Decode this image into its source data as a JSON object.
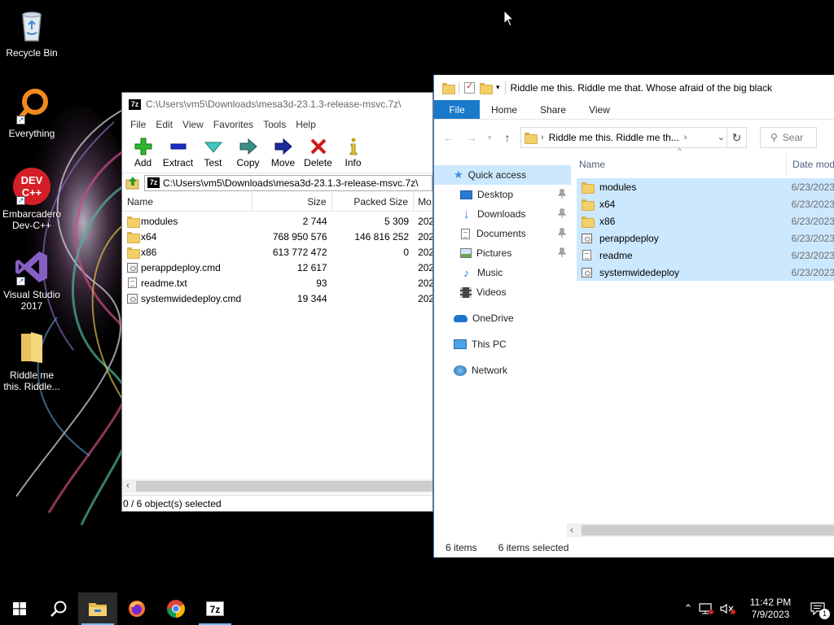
{
  "desktop": {
    "icons": [
      {
        "label": "Recycle Bin"
      },
      {
        "label": "Everything"
      },
      {
        "label": "Embarcadero Dev-C++",
        "badge": "DEV C++"
      },
      {
        "label": "Visual Studio 2017"
      },
      {
        "label": "Riddle me this. Riddle..."
      }
    ]
  },
  "zip": {
    "title": "C:\\Users\\vm5\\Downloads\\mesa3d-23.1.3-release-msvc.7z\\",
    "logo": "7z",
    "menu": [
      "File",
      "Edit",
      "View",
      "Favorites",
      "Tools",
      "Help"
    ],
    "toolbar": [
      "Add",
      "Extract",
      "Test",
      "Copy",
      "Move",
      "Delete",
      "Info"
    ],
    "address": "C:\\Users\\vm5\\Downloads\\mesa3d-23.1.3-release-msvc.7z\\",
    "columns": {
      "name": "Name",
      "size": "Size",
      "packed": "Packed Size",
      "modified": "Mo"
    },
    "rows": [
      {
        "name": "modules",
        "size": "2 744",
        "packed": "5 309",
        "modified": "202",
        "type": "folder"
      },
      {
        "name": "x64",
        "size": "768 950 576",
        "packed": "146 816 252",
        "modified": "202",
        "type": "folder"
      },
      {
        "name": "x86",
        "size": "613 772 472",
        "packed": "0",
        "modified": "202",
        "type": "folder"
      },
      {
        "name": "perappdeploy.cmd",
        "size": "12 617",
        "packed": "",
        "modified": "202",
        "type": "cmd"
      },
      {
        "name": "readme.txt",
        "size": "93",
        "packed": "",
        "modified": "202",
        "type": "txt"
      },
      {
        "name": "systemwidedeploy.cmd",
        "size": "19 344",
        "packed": "",
        "modified": "202",
        "type": "cmd"
      }
    ],
    "status": "0 / 6 object(s) selected"
  },
  "explorer": {
    "title": "Riddle me this. Riddle me that. Whose afraid of the big black",
    "ribbon_tabs": [
      "File",
      "Home",
      "Share",
      "View"
    ],
    "address": "Riddle me this. Riddle me th...",
    "search_placeholder": "Sear",
    "nav_pane": [
      {
        "label": "Quick access",
        "pinned": false
      },
      {
        "label": "Desktop",
        "pinned": true
      },
      {
        "label": "Downloads",
        "pinned": true
      },
      {
        "label": "Documents",
        "pinned": true
      },
      {
        "label": "Pictures",
        "pinned": true
      },
      {
        "label": "Music",
        "pinned": false
      },
      {
        "label": "Videos",
        "pinned": false
      },
      {
        "label": "OneDrive",
        "pinned": false
      },
      {
        "label": "This PC",
        "pinned": false
      },
      {
        "label": "Network",
        "pinned": false
      }
    ],
    "columns": {
      "name": "Name",
      "date": "Date mod"
    },
    "rows": [
      {
        "name": "modules",
        "date": "6/23/2023",
        "type": "folder"
      },
      {
        "name": "x64",
        "date": "6/23/2023",
        "type": "folder"
      },
      {
        "name": "x86",
        "date": "6/23/2023",
        "type": "folder"
      },
      {
        "name": "perappdeploy",
        "date": "6/23/2023",
        "type": "cmd"
      },
      {
        "name": "readme",
        "date": "6/23/2023",
        "type": "txt"
      },
      {
        "name": "systemwidedeploy",
        "date": "6/23/2023",
        "type": "cmd"
      }
    ],
    "status": {
      "items": "6 items",
      "selected": "6 items selected"
    }
  },
  "taskbar": {
    "apps": [
      "start",
      "search",
      "file-explorer",
      "firefox",
      "chrome",
      "7-zip"
    ],
    "time": "11:42 PM",
    "date": "7/9/2023",
    "notification_count": "1"
  }
}
